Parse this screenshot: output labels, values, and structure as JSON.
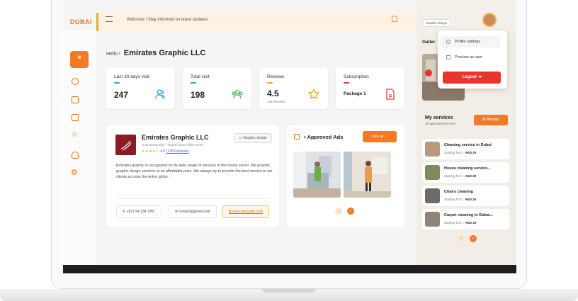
{
  "app": {
    "logo_text": "DUBAI",
    "welcome": "Welcome ! Stay informed on latest updates."
  },
  "greeting": {
    "hello": "Hello !",
    "company": "Emirates Graphic LLC"
  },
  "stats": [
    {
      "label": "Last 30 days visit",
      "value": "247",
      "accent": "#22a4d8"
    },
    {
      "label": "Total visit",
      "value": "198",
      "accent": "#3cb64a"
    },
    {
      "label": "Reviews",
      "value": "4.5",
      "sub": "138 Reviews",
      "accent": "#f2a312"
    },
    {
      "label": "Subscription",
      "value": "Package 1",
      "accent": "#e8342f"
    }
  ],
  "company_card": {
    "name": "Emirates Graphic LLC",
    "address": "Business Bay - Marasi Drive Office 2013",
    "rating": "4.5",
    "reviews_link": "(138 Reviews)",
    "category": "Graphic design",
    "description": "Emirates graphic is recognized for its wide range of services in the media sector. We provide, graphic design services at an affordable price. We always try to provide the best service to our clients accross the entire globe.",
    "phone": "+971 54 234 3367",
    "email": "contact@gmail.com",
    "website": "www.demosite.com"
  },
  "ads_card": {
    "title": "Approved Ads",
    "view_all": "View all"
  },
  "right_panel": {
    "category_tag": "Graphic design",
    "gallery_label": "Galler",
    "menu": {
      "profile_settings": "Profile settings",
      "preview": "Preview as user",
      "logout": "Logout"
    }
  },
  "services": {
    "title": "My services",
    "subtitle": "All approved services",
    "manage": "Manage",
    "items": [
      {
        "name": "Cleaning service in Dubai",
        "price_label": "Starting from :",
        "price": "AED 20"
      },
      {
        "name": "House cleaning service...",
        "price_label": "Starting from :",
        "price": "AED 20"
      },
      {
        "name": "Chairs cleaning",
        "price_label": "Starting from :",
        "price": "AED 20"
      },
      {
        "name": "Carpet cleaning in Dubai...",
        "price_label": "Starting from :",
        "price": "AED 20"
      }
    ]
  },
  "colors": {
    "accent": "#f37a22",
    "logout": "#e8342f"
  }
}
